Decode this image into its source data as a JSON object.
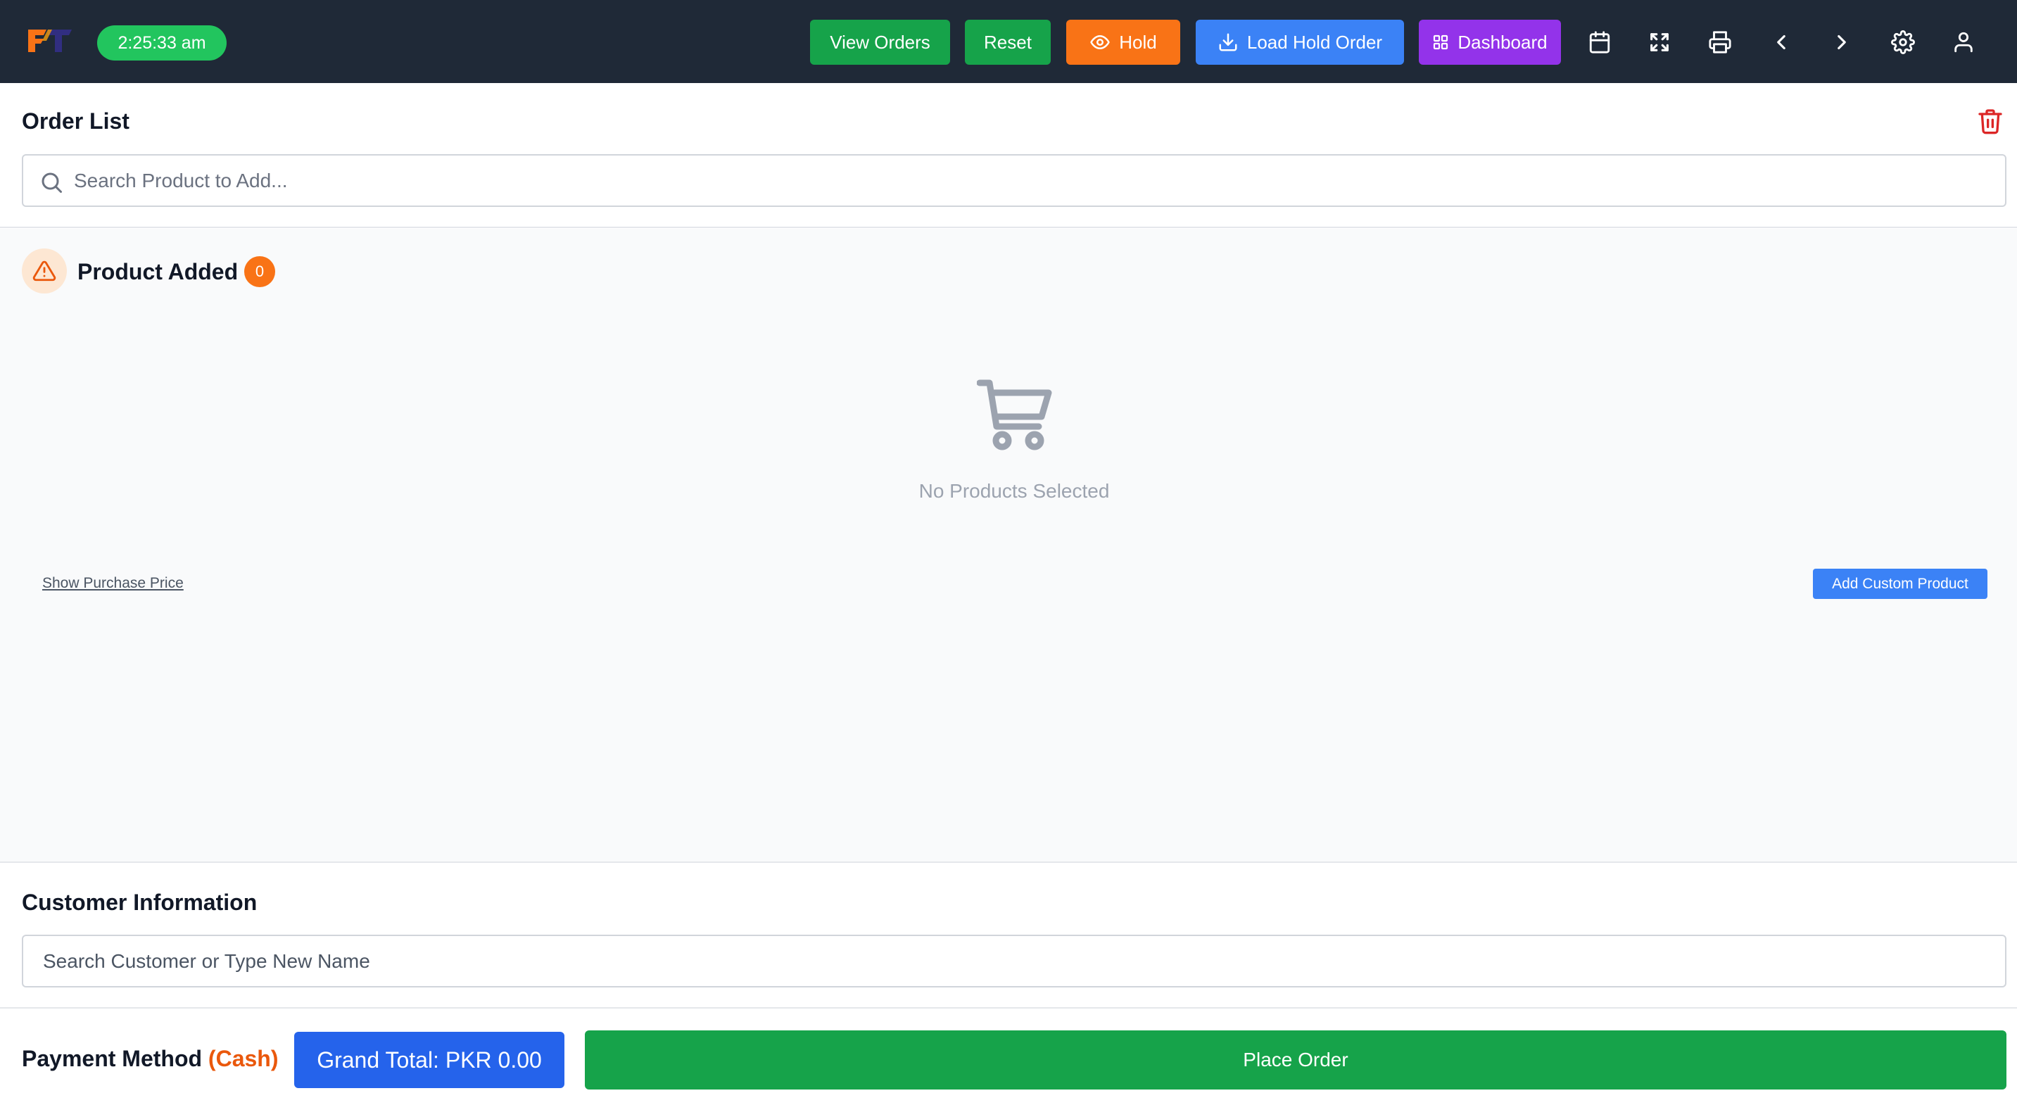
{
  "header": {
    "clock": "2:25:33 am",
    "buttons": {
      "view_orders": "View Orders",
      "reset": "Reset",
      "hold": "Hold",
      "load_hold_order": "Load Hold Order",
      "dashboard": "Dashboard"
    },
    "icons": [
      "calendar-icon",
      "fullscreen-icon",
      "printer-icon",
      "chevron-left-icon",
      "chevron-right-icon",
      "gear-icon",
      "user-icon"
    ],
    "colors": {
      "bar": "#1f2937",
      "clock": "#22c55e",
      "view_orders": "#16a34a",
      "reset": "#16a34a",
      "hold": "#f97316",
      "load_hold_order": "#3b82f6",
      "dashboard": "#9333ea"
    }
  },
  "order_list": {
    "title": "Order List",
    "search_placeholder": "Search Product to Add..."
  },
  "products": {
    "title": "Product Added",
    "count": "0",
    "empty_message": "No Products Selected",
    "show_purchase_price": "Show Purchase Price",
    "add_custom_product": "Add Custom Product"
  },
  "customer": {
    "title": "Customer Information",
    "search_placeholder": "Search Customer or Type New Name"
  },
  "footer": {
    "payment_label": "Payment Method",
    "payment_value": "(Cash)",
    "grand_total": "Grand Total: PKR 0.00",
    "place_order": "Place Order",
    "colors": {
      "grand_total": "#2563eb",
      "place_order": "#16a34a",
      "payment_value": "#ea580c"
    }
  }
}
